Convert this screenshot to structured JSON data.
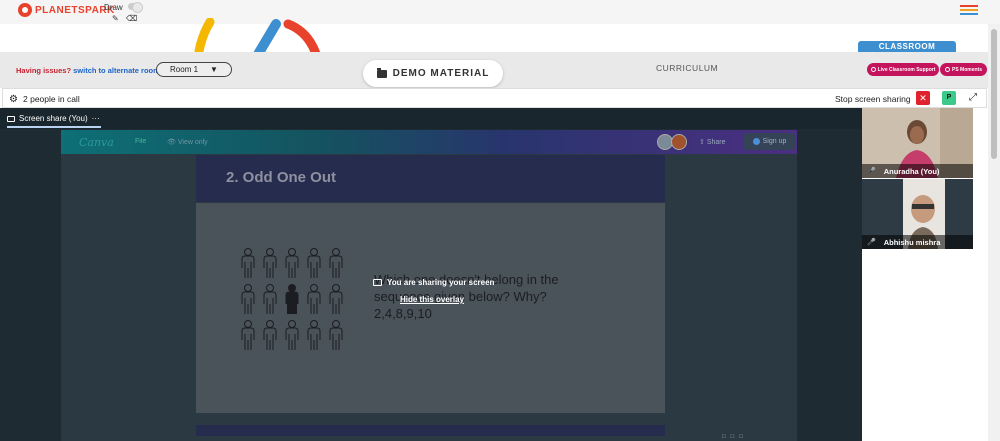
{
  "brand": {
    "name": "PLANETSPARK"
  },
  "toolbar": {
    "draw_label": "Draw"
  },
  "banner": {
    "issues_text": "Having issues?",
    "switch_text": "switch to alternate room",
    "room_value": "Room 1"
  },
  "tabs": {
    "demo_material": "DEMO MATERIAL",
    "curriculum": "CURRICULUM",
    "classroom": "CLASSROOM"
  },
  "actions": {
    "live_support": "Live Classroom Support",
    "ps_moments": "PS Moments"
  },
  "call": {
    "people_count": "2 people in call",
    "stop_sharing": "Stop screen sharing",
    "p_label": "P"
  },
  "stage": {
    "tab_label": "Screen share (You)",
    "tab_more": "···"
  },
  "canva": {
    "logo": "Canva",
    "file": "File",
    "view_only": "View only",
    "share": "Share",
    "signup": "Sign up"
  },
  "slide": {
    "title": "2. Odd One Out",
    "question_line1": "Which one doesn't belong in the",
    "question_line2": "sequence given below? Why?",
    "sequence": "2,4,8,9,10"
  },
  "overlay": {
    "message": "You are sharing your screen",
    "hide": "Hide this overlay"
  },
  "participants": [
    {
      "name": "Anuradha (You)"
    },
    {
      "name": "Abhishu mishra"
    }
  ],
  "colors": {
    "brand": "#e8412c",
    "accent_blue": "#3d8fd0",
    "magenta": "#c3145d",
    "danger": "#e0222f",
    "success": "#3cc98a"
  }
}
